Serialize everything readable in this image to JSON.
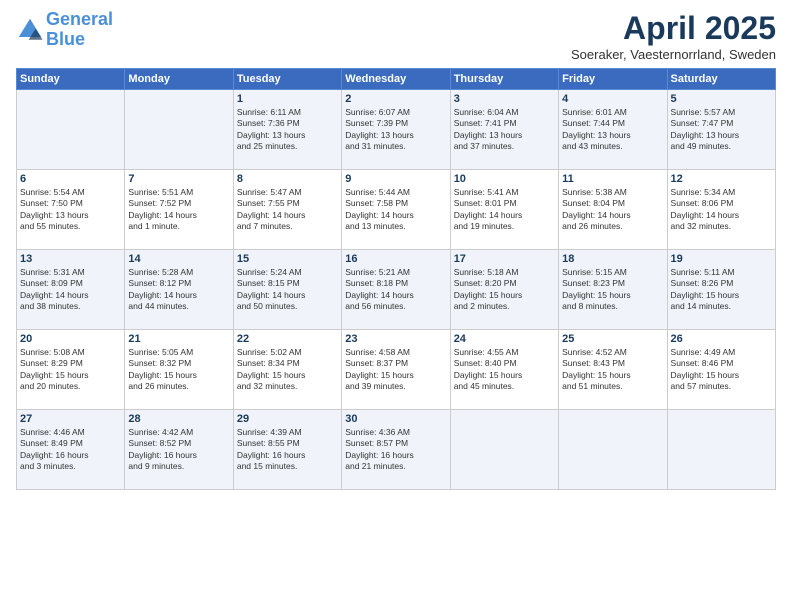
{
  "header": {
    "logo_line1": "General",
    "logo_line2": "Blue",
    "month": "April 2025",
    "location": "Soeraker, Vaesternorrland, Sweden"
  },
  "days_of_week": [
    "Sunday",
    "Monday",
    "Tuesday",
    "Wednesday",
    "Thursday",
    "Friday",
    "Saturday"
  ],
  "weeks": [
    [
      {
        "num": "",
        "info": ""
      },
      {
        "num": "",
        "info": ""
      },
      {
        "num": "1",
        "info": "Sunrise: 6:11 AM\nSunset: 7:36 PM\nDaylight: 13 hours\nand 25 minutes."
      },
      {
        "num": "2",
        "info": "Sunrise: 6:07 AM\nSunset: 7:39 PM\nDaylight: 13 hours\nand 31 minutes."
      },
      {
        "num": "3",
        "info": "Sunrise: 6:04 AM\nSunset: 7:41 PM\nDaylight: 13 hours\nand 37 minutes."
      },
      {
        "num": "4",
        "info": "Sunrise: 6:01 AM\nSunset: 7:44 PM\nDaylight: 13 hours\nand 43 minutes."
      },
      {
        "num": "5",
        "info": "Sunrise: 5:57 AM\nSunset: 7:47 PM\nDaylight: 13 hours\nand 49 minutes."
      }
    ],
    [
      {
        "num": "6",
        "info": "Sunrise: 5:54 AM\nSunset: 7:50 PM\nDaylight: 13 hours\nand 55 minutes."
      },
      {
        "num": "7",
        "info": "Sunrise: 5:51 AM\nSunset: 7:52 PM\nDaylight: 14 hours\nand 1 minute."
      },
      {
        "num": "8",
        "info": "Sunrise: 5:47 AM\nSunset: 7:55 PM\nDaylight: 14 hours\nand 7 minutes."
      },
      {
        "num": "9",
        "info": "Sunrise: 5:44 AM\nSunset: 7:58 PM\nDaylight: 14 hours\nand 13 minutes."
      },
      {
        "num": "10",
        "info": "Sunrise: 5:41 AM\nSunset: 8:01 PM\nDaylight: 14 hours\nand 19 minutes."
      },
      {
        "num": "11",
        "info": "Sunrise: 5:38 AM\nSunset: 8:04 PM\nDaylight: 14 hours\nand 26 minutes."
      },
      {
        "num": "12",
        "info": "Sunrise: 5:34 AM\nSunset: 8:06 PM\nDaylight: 14 hours\nand 32 minutes."
      }
    ],
    [
      {
        "num": "13",
        "info": "Sunrise: 5:31 AM\nSunset: 8:09 PM\nDaylight: 14 hours\nand 38 minutes."
      },
      {
        "num": "14",
        "info": "Sunrise: 5:28 AM\nSunset: 8:12 PM\nDaylight: 14 hours\nand 44 minutes."
      },
      {
        "num": "15",
        "info": "Sunrise: 5:24 AM\nSunset: 8:15 PM\nDaylight: 14 hours\nand 50 minutes."
      },
      {
        "num": "16",
        "info": "Sunrise: 5:21 AM\nSunset: 8:18 PM\nDaylight: 14 hours\nand 56 minutes."
      },
      {
        "num": "17",
        "info": "Sunrise: 5:18 AM\nSunset: 8:20 PM\nDaylight: 15 hours\nand 2 minutes."
      },
      {
        "num": "18",
        "info": "Sunrise: 5:15 AM\nSunset: 8:23 PM\nDaylight: 15 hours\nand 8 minutes."
      },
      {
        "num": "19",
        "info": "Sunrise: 5:11 AM\nSunset: 8:26 PM\nDaylight: 15 hours\nand 14 minutes."
      }
    ],
    [
      {
        "num": "20",
        "info": "Sunrise: 5:08 AM\nSunset: 8:29 PM\nDaylight: 15 hours\nand 20 minutes."
      },
      {
        "num": "21",
        "info": "Sunrise: 5:05 AM\nSunset: 8:32 PM\nDaylight: 15 hours\nand 26 minutes."
      },
      {
        "num": "22",
        "info": "Sunrise: 5:02 AM\nSunset: 8:34 PM\nDaylight: 15 hours\nand 32 minutes."
      },
      {
        "num": "23",
        "info": "Sunrise: 4:58 AM\nSunset: 8:37 PM\nDaylight: 15 hours\nand 39 minutes."
      },
      {
        "num": "24",
        "info": "Sunrise: 4:55 AM\nSunset: 8:40 PM\nDaylight: 15 hours\nand 45 minutes."
      },
      {
        "num": "25",
        "info": "Sunrise: 4:52 AM\nSunset: 8:43 PM\nDaylight: 15 hours\nand 51 minutes."
      },
      {
        "num": "26",
        "info": "Sunrise: 4:49 AM\nSunset: 8:46 PM\nDaylight: 15 hours\nand 57 minutes."
      }
    ],
    [
      {
        "num": "27",
        "info": "Sunrise: 4:46 AM\nSunset: 8:49 PM\nDaylight: 16 hours\nand 3 minutes."
      },
      {
        "num": "28",
        "info": "Sunrise: 4:42 AM\nSunset: 8:52 PM\nDaylight: 16 hours\nand 9 minutes."
      },
      {
        "num": "29",
        "info": "Sunrise: 4:39 AM\nSunset: 8:55 PM\nDaylight: 16 hours\nand 15 minutes."
      },
      {
        "num": "30",
        "info": "Sunrise: 4:36 AM\nSunset: 8:57 PM\nDaylight: 16 hours\nand 21 minutes."
      },
      {
        "num": "",
        "info": ""
      },
      {
        "num": "",
        "info": ""
      },
      {
        "num": "",
        "info": ""
      }
    ]
  ]
}
